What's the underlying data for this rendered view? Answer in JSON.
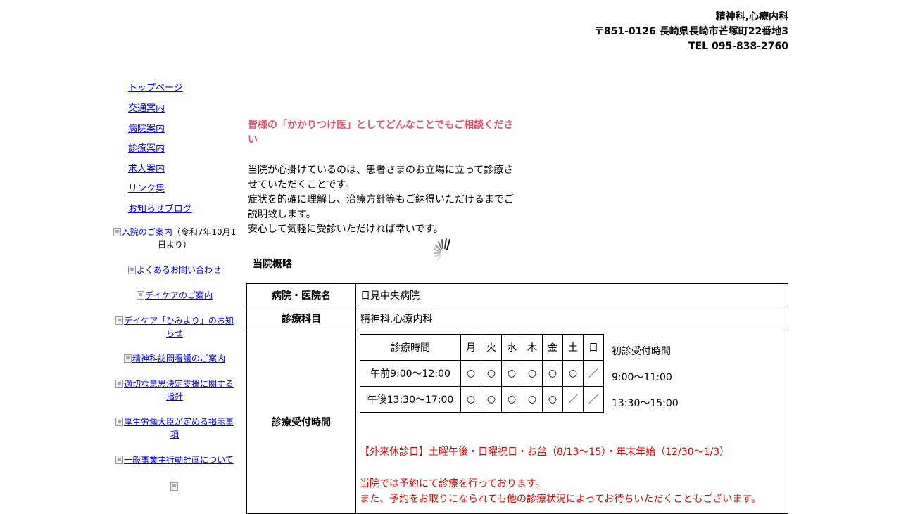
{
  "header": {
    "specialty": "精神科,心療内科",
    "address": "〒851-0126 長崎県長崎市芒塚町22番地3",
    "tel": "TEL 095-838-2760"
  },
  "sidebar": {
    "nav": [
      "トップページ",
      "交通案内",
      "病院案内",
      "診療案内",
      "求人案内",
      "リンク集",
      "お知らせブログ"
    ],
    "banners": [
      {
        "text": "入院のご案内",
        "note": "（令和7年10月1日より）"
      },
      {
        "text": "よくあるお問い合わせ"
      },
      {
        "text": "デイケアのご案内"
      },
      {
        "text": "デイケア「ひみより」のお知らせ"
      },
      {
        "text": "精神科訪問看護のご案内"
      },
      {
        "text": "適切な意思決定支援に関する指針"
      },
      {
        "text": "厚生労働大臣が定める掲示事項"
      },
      {
        "text": "一般事業主行動計画について"
      }
    ]
  },
  "intro": {
    "heading": "皆様の「かかりつけ医」としてどんなことでもご相談ください",
    "paragraphs": [
      "当院が心掛けているのは、患者さまのお立場に立って診療させていただくことです。",
      "症状を的確に理解し、治療方針等もご納得いただけるまでご説明致します。",
      "安心して気軽に受診いただければ幸いです。"
    ]
  },
  "overview": {
    "heading": "当院概略",
    "name_label": "病院・医院名",
    "name_value": "日見中央病院",
    "dept_label": "診療科目",
    "dept_value": "精神科,心療内科",
    "hours_label": "診療受付時間"
  },
  "hours": {
    "header": "診療時間",
    "days": [
      "月",
      "火",
      "水",
      "木",
      "金",
      "土",
      "日"
    ],
    "rows": [
      {
        "label": "午前9:00～12:00",
        "marks": [
          "○",
          "○",
          "○",
          "○",
          "○",
          "○",
          "／"
        ]
      },
      {
        "label": "午後13:30～17:00",
        "marks": [
          "○",
          "○",
          "○",
          "○",
          "○",
          "／",
          "／"
        ]
      }
    ],
    "first_visit_title": "初診受付時間",
    "first_visit_times": [
      "9:00～11:00",
      "13:30～15:00"
    ],
    "closed_note": "【外来休診日】土曜午後・日曜祝日・お盆（8/13～15）・年末年始（12/30～1/3）",
    "reserve_notes": [
      "当院では予約にて診療を行っております。",
      "また、予約をお取りになられても他の診療状況によってお待ちいただくこともございます。"
    ]
  },
  "colors": {
    "heading_pink": "#e05070",
    "notice_red": "#e00000",
    "link_blue": "#0000ee"
  }
}
